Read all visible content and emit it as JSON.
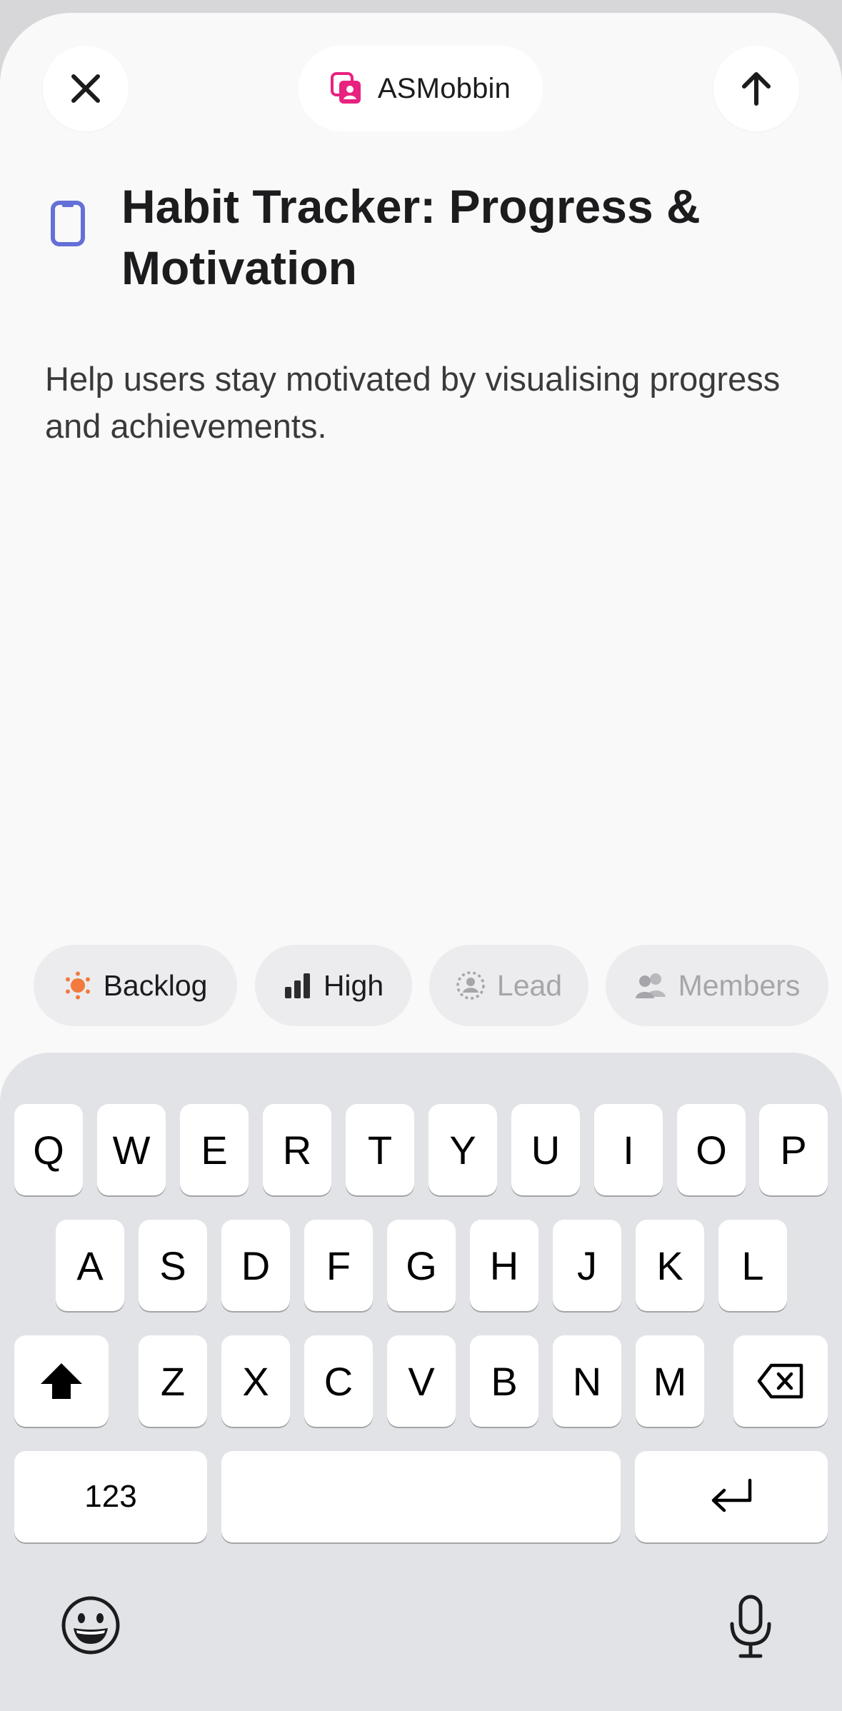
{
  "header": {
    "team_name": "ASMobbin",
    "close_icon": "close-icon",
    "send_icon": "arrow-up-icon",
    "team_icon": "team-avatar-icon",
    "team_color": "#e8227f"
  },
  "issue": {
    "title": "Habit Tracker: Progress & Motivation",
    "description": "Help users stay motivated by visualising progress and achievements.",
    "icon": "mobile-device-icon",
    "icon_color": "#6470d8"
  },
  "chips": {
    "status": "Backlog",
    "status_color": "#f27a3c",
    "priority": "High",
    "lead": "Lead",
    "members": "Members"
  },
  "keyboard": {
    "row1": [
      "Q",
      "W",
      "E",
      "R",
      "T",
      "Y",
      "U",
      "I",
      "O",
      "P"
    ],
    "row2": [
      "A",
      "S",
      "D",
      "F",
      "G",
      "H",
      "J",
      "K",
      "L"
    ],
    "row3": [
      "Z",
      "X",
      "C",
      "V",
      "B",
      "N",
      "M"
    ],
    "numbers_label": "123",
    "shift_icon": "shift-icon",
    "delete_icon": "backspace-icon",
    "return_icon": "return-icon",
    "emoji_icon": "emoji-icon",
    "mic_icon": "microphone-icon"
  }
}
